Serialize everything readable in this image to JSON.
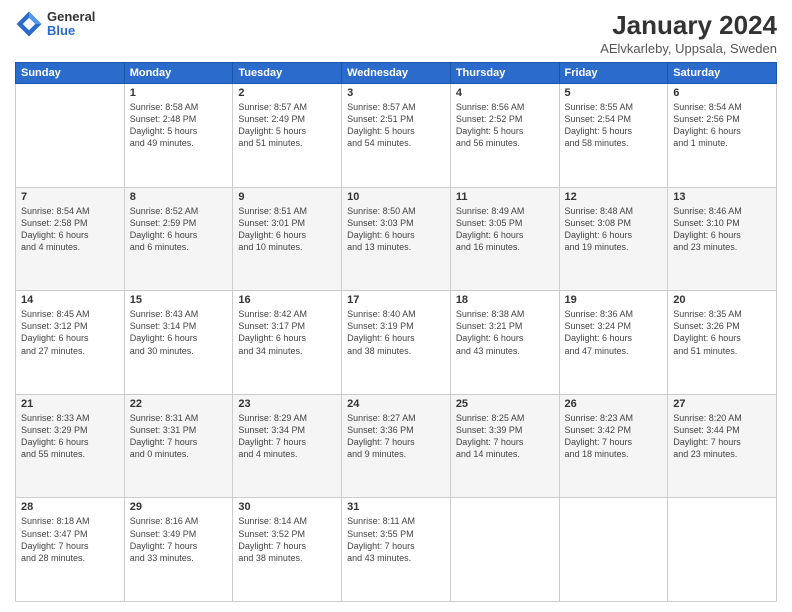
{
  "header": {
    "logo": {
      "general": "General",
      "blue": "Blue"
    },
    "title": "January 2024",
    "subtitle": "AElvkarleby, Uppsala, Sweden"
  },
  "weekdays": [
    "Sunday",
    "Monday",
    "Tuesday",
    "Wednesday",
    "Thursday",
    "Friday",
    "Saturday"
  ],
  "weeks": [
    [
      {
        "date": "",
        "info": ""
      },
      {
        "date": "1",
        "info": "Sunrise: 8:58 AM\nSunset: 2:48 PM\nDaylight: 5 hours\nand 49 minutes."
      },
      {
        "date": "2",
        "info": "Sunrise: 8:57 AM\nSunset: 2:49 PM\nDaylight: 5 hours\nand 51 minutes."
      },
      {
        "date": "3",
        "info": "Sunrise: 8:57 AM\nSunset: 2:51 PM\nDaylight: 5 hours\nand 54 minutes."
      },
      {
        "date": "4",
        "info": "Sunrise: 8:56 AM\nSunset: 2:52 PM\nDaylight: 5 hours\nand 56 minutes."
      },
      {
        "date": "5",
        "info": "Sunrise: 8:55 AM\nSunset: 2:54 PM\nDaylight: 5 hours\nand 58 minutes."
      },
      {
        "date": "6",
        "info": "Sunrise: 8:54 AM\nSunset: 2:56 PM\nDaylight: 6 hours\nand 1 minute."
      }
    ],
    [
      {
        "date": "7",
        "info": "Sunrise: 8:54 AM\nSunset: 2:58 PM\nDaylight: 6 hours\nand 4 minutes."
      },
      {
        "date": "8",
        "info": "Sunrise: 8:52 AM\nSunset: 2:59 PM\nDaylight: 6 hours\nand 6 minutes."
      },
      {
        "date": "9",
        "info": "Sunrise: 8:51 AM\nSunset: 3:01 PM\nDaylight: 6 hours\nand 10 minutes."
      },
      {
        "date": "10",
        "info": "Sunrise: 8:50 AM\nSunset: 3:03 PM\nDaylight: 6 hours\nand 13 minutes."
      },
      {
        "date": "11",
        "info": "Sunrise: 8:49 AM\nSunset: 3:05 PM\nDaylight: 6 hours\nand 16 minutes."
      },
      {
        "date": "12",
        "info": "Sunrise: 8:48 AM\nSunset: 3:08 PM\nDaylight: 6 hours\nand 19 minutes."
      },
      {
        "date": "13",
        "info": "Sunrise: 8:46 AM\nSunset: 3:10 PM\nDaylight: 6 hours\nand 23 minutes."
      }
    ],
    [
      {
        "date": "14",
        "info": "Sunrise: 8:45 AM\nSunset: 3:12 PM\nDaylight: 6 hours\nand 27 minutes."
      },
      {
        "date": "15",
        "info": "Sunrise: 8:43 AM\nSunset: 3:14 PM\nDaylight: 6 hours\nand 30 minutes."
      },
      {
        "date": "16",
        "info": "Sunrise: 8:42 AM\nSunset: 3:17 PM\nDaylight: 6 hours\nand 34 minutes."
      },
      {
        "date": "17",
        "info": "Sunrise: 8:40 AM\nSunset: 3:19 PM\nDaylight: 6 hours\nand 38 minutes."
      },
      {
        "date": "18",
        "info": "Sunrise: 8:38 AM\nSunset: 3:21 PM\nDaylight: 6 hours\nand 43 minutes."
      },
      {
        "date": "19",
        "info": "Sunrise: 8:36 AM\nSunset: 3:24 PM\nDaylight: 6 hours\nand 47 minutes."
      },
      {
        "date": "20",
        "info": "Sunrise: 8:35 AM\nSunset: 3:26 PM\nDaylight: 6 hours\nand 51 minutes."
      }
    ],
    [
      {
        "date": "21",
        "info": "Sunrise: 8:33 AM\nSunset: 3:29 PM\nDaylight: 6 hours\nand 55 minutes."
      },
      {
        "date": "22",
        "info": "Sunrise: 8:31 AM\nSunset: 3:31 PM\nDaylight: 7 hours\nand 0 minutes."
      },
      {
        "date": "23",
        "info": "Sunrise: 8:29 AM\nSunset: 3:34 PM\nDaylight: 7 hours\nand 4 minutes."
      },
      {
        "date": "24",
        "info": "Sunrise: 8:27 AM\nSunset: 3:36 PM\nDaylight: 7 hours\nand 9 minutes."
      },
      {
        "date": "25",
        "info": "Sunrise: 8:25 AM\nSunset: 3:39 PM\nDaylight: 7 hours\nand 14 minutes."
      },
      {
        "date": "26",
        "info": "Sunrise: 8:23 AM\nSunset: 3:42 PM\nDaylight: 7 hours\nand 18 minutes."
      },
      {
        "date": "27",
        "info": "Sunrise: 8:20 AM\nSunset: 3:44 PM\nDaylight: 7 hours\nand 23 minutes."
      }
    ],
    [
      {
        "date": "28",
        "info": "Sunrise: 8:18 AM\nSunset: 3:47 PM\nDaylight: 7 hours\nand 28 minutes."
      },
      {
        "date": "29",
        "info": "Sunrise: 8:16 AM\nSunset: 3:49 PM\nDaylight: 7 hours\nand 33 minutes."
      },
      {
        "date": "30",
        "info": "Sunrise: 8:14 AM\nSunset: 3:52 PM\nDaylight: 7 hours\nand 38 minutes."
      },
      {
        "date": "31",
        "info": "Sunrise: 8:11 AM\nSunset: 3:55 PM\nDaylight: 7 hours\nand 43 minutes."
      },
      {
        "date": "",
        "info": ""
      },
      {
        "date": "",
        "info": ""
      },
      {
        "date": "",
        "info": ""
      }
    ]
  ]
}
